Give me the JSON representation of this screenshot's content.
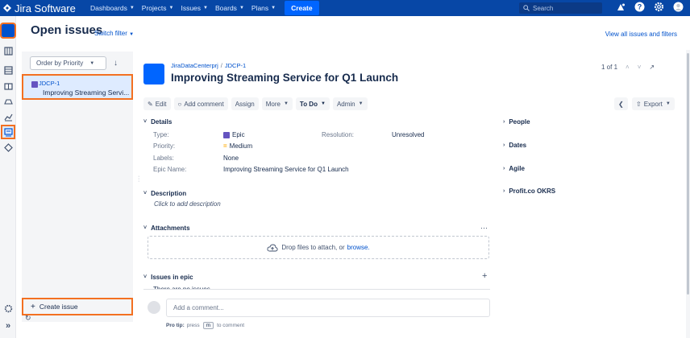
{
  "topbar": {
    "app_name": "Jira Software",
    "nav": [
      {
        "label": "Dashboards"
      },
      {
        "label": "Projects"
      },
      {
        "label": "Issues"
      },
      {
        "label": "Boards"
      },
      {
        "label": "Plans"
      }
    ],
    "create_label": "Create",
    "search_placeholder": "Search"
  },
  "header": {
    "title": "Open issues",
    "switch_filter": "Switch filter",
    "view_all": "View all issues and filters"
  },
  "list": {
    "order_label": "Order by Priority",
    "items": [
      {
        "key": "JDCP-1",
        "summary": "Improving Streaming Servi..."
      }
    ],
    "create_issue": "Create issue"
  },
  "issue": {
    "project": "JiraDataCenterprj",
    "key": "JDCP-1",
    "title": "Improving Streaming Service for Q1 Launch",
    "pager": "1 of 1",
    "toolbar": {
      "edit": "Edit",
      "add_comment": "Add comment",
      "assign": "Assign",
      "more": "More",
      "status": "To Do",
      "admin": "Admin",
      "export": "Export"
    },
    "details": {
      "heading": "Details",
      "type_label": "Type:",
      "type_value": "Epic",
      "priority_label": "Priority:",
      "priority_value": "Medium",
      "labels_label": "Labels:",
      "labels_value": "None",
      "epic_name_label": "Epic Name:",
      "epic_name_value": "Improving Streaming Service for Q1 Launch",
      "resolution_label": "Resolution:",
      "resolution_value": "Unresolved"
    },
    "description": {
      "heading": "Description",
      "placeholder": "Click to add description"
    },
    "attachments": {
      "heading": "Attachments",
      "drop_text": "Drop files to attach, or",
      "browse": "browse."
    },
    "issues_in_epic": {
      "heading": "Issues in epic",
      "empty": "There are no issues"
    },
    "comment": {
      "placeholder": "Add a comment...",
      "protip_label": "Pro tip:",
      "protip_press": "press",
      "protip_key": "m",
      "protip_rest": "to comment"
    },
    "side": {
      "people": "People",
      "dates": "Dates",
      "agile": "Agile",
      "okrs": "Profit.co OKRS"
    }
  },
  "colors": {
    "topbar": "#0747a6",
    "highlight": "#f37021",
    "link": "#0052cc",
    "epic": "#6554c0"
  }
}
